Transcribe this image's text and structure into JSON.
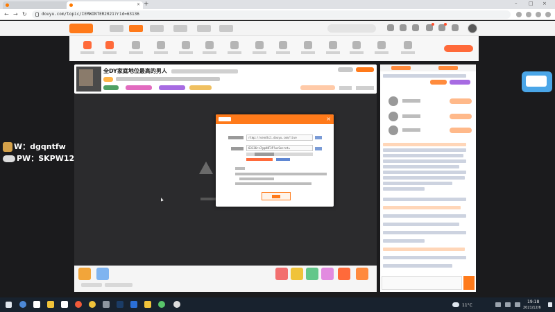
{
  "browser": {
    "tabs": [
      {
        "title": ""
      },
      {
        "title": ""
      }
    ],
    "url": "douyu.com/topic/IEMWINTER2021?rid=63136"
  },
  "room": {
    "title": "全DY家庭地位最高的男人"
  },
  "modal": {
    "rtmp_value": "rtmp://sendtc1.douyu.com/live",
    "key_value": "63136rc7gqdHF3P?wsSecret="
  },
  "watermark": {
    "w_line": "W：dgqntfw",
    "pw_line": "PW：SKPW12"
  },
  "taskbar": {
    "weather": "11°C",
    "time": "19:18",
    "date": "2021/12/6"
  },
  "colors": {
    "brand": "#ff7a1a",
    "tab_active": "#ffffff",
    "taskbar": "#18222e"
  }
}
